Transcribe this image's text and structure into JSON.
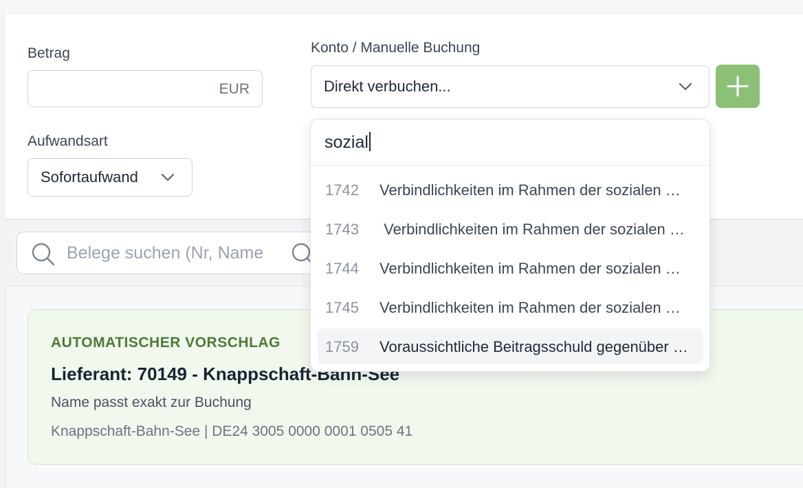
{
  "form": {
    "amount_label": "Betrag",
    "amount_value": "",
    "amount_currency": "EUR",
    "konto_label": "Konto / Manuelle Buchung",
    "konto_selected": "Direkt verbuchen...",
    "expense_type_label": "Aufwandsart",
    "expense_type_selected": "Sofortaufwand"
  },
  "search": {
    "placeholder": "Belege suchen (Nr, Name"
  },
  "dropdown": {
    "query": "sozial",
    "options": [
      {
        "number": "1742",
        "text": "Verbindlichkeiten im Rahmen der sozialen Sicherheit"
      },
      {
        "number": "1743",
        "text": " Verbindlichkeiten im Rahmen der sozialen Sicherheit"
      },
      {
        "number": "1744",
        "text": "Verbindlichkeiten im Rahmen der sozialen Sicherheit"
      },
      {
        "number": "1745",
        "text": "Verbindlichkeiten im Rahmen der sozialen Sicherheit"
      },
      {
        "number": "1759",
        "text": "Voraussichtliche Beitragsschuld gegenüber den Sozialversicherungsträgern"
      }
    ]
  },
  "suggestion": {
    "kicker": "AUTOMATISCHER VORSCHLAG",
    "supplier": "Lieferant: 70149 - Knappschaft-Bahn-See",
    "reason": "Name passt exakt zur Buchung",
    "bank": "Knappschaft-Bahn-See | DE24 3005 0000 0001 0505 41"
  },
  "colors": {
    "accent_green": "#8cc077",
    "kicker_green": "#4d7a35",
    "card_bg": "#f1f8ee"
  },
  "icons": [
    "chevron-down-icon",
    "plus-icon",
    "search-icon"
  ]
}
